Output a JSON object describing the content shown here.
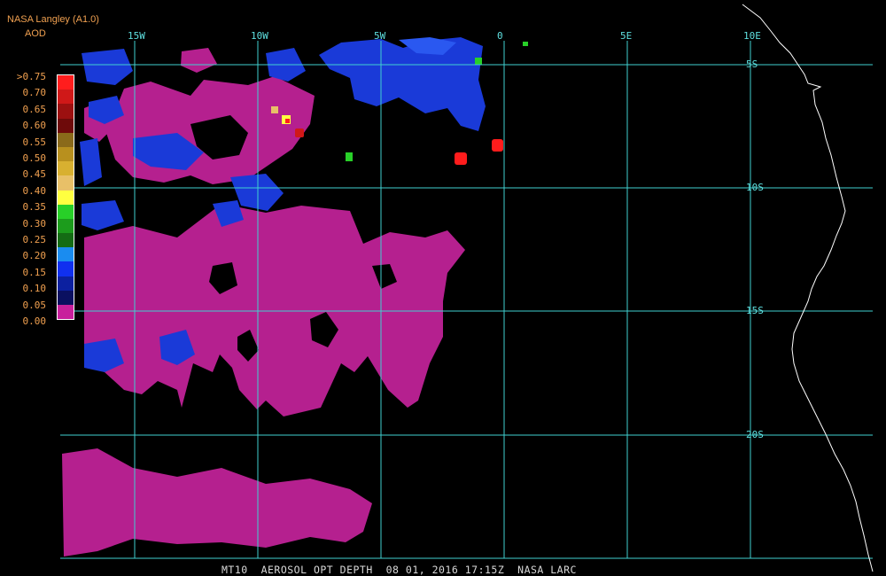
{
  "header": {
    "title": "NASA Langley (A1.0)",
    "subtitle": "AOD"
  },
  "legend": {
    "labels": [
      ">0.75",
      "0.70",
      "0.65",
      "0.60",
      "0.55",
      "0.50",
      "0.45",
      "0.40",
      "0.35",
      "0.30",
      "0.25",
      "0.20",
      "0.15",
      "0.10",
      "0.05",
      "0.00"
    ],
    "colors": [
      "#ff1d1d",
      "#d01818",
      "#9c1010",
      "#6e0a0a",
      "#8a6a1a",
      "#b8901e",
      "#d8b030",
      "#e8c068",
      "#ffff40",
      "#28d028",
      "#1c9c1c",
      "#146c14",
      "#1a8cf0",
      "#1030f0",
      "#0c20a0",
      "#0a1060",
      "#c8209c"
    ]
  },
  "longitude_labels": [
    "15W",
    "10W",
    "5W",
    "0",
    "5E",
    "10E"
  ],
  "latitude_labels": [
    "5S",
    "10S",
    "15S",
    "20S"
  ],
  "footer": {
    "product": "MT10",
    "variable": "AEROSOL OPT DEPTH",
    "date": "08 01, 2016",
    "time": "17:15Z",
    "source": "NASA LARC"
  },
  "colors": {
    "grid": "#40d0d0",
    "coast": "#ffffff",
    "aod_low": "#b5208f",
    "aod_blue": "#1a3ad8",
    "aod_high": "#ff1c1c"
  }
}
